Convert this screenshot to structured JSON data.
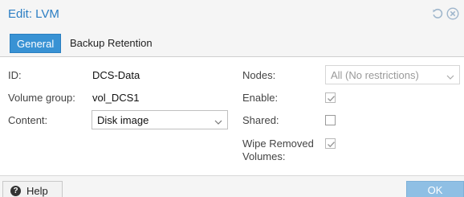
{
  "window": {
    "title": "Edit: LVM"
  },
  "tabs": [
    {
      "label": "General",
      "active": true
    },
    {
      "label": "Backup Retention",
      "active": false
    }
  ],
  "form": {
    "id": {
      "label": "ID:",
      "value": "DCS-Data"
    },
    "volume_group": {
      "label": "Volume group:",
      "value": "vol_DCS1"
    },
    "content": {
      "label": "Content:",
      "value": "Disk image"
    },
    "nodes": {
      "label": "Nodes:",
      "value": "All (No restrictions)",
      "disabled": true
    },
    "enable": {
      "label": "Enable:",
      "checked": true
    },
    "shared": {
      "label": "Shared:",
      "checked": false
    },
    "wipe_removed_volumes": {
      "label_line1": "Wipe Removed",
      "label_line2": "Volumes:",
      "checked": true
    }
  },
  "footer": {
    "help_label": "Help",
    "help_icon": "question-icon",
    "ok_label": "OK"
  },
  "colors": {
    "title": "#2b7ec4",
    "active_tab": "#3892d4",
    "ok_button_disabled": "#8fbfe4"
  },
  "icons": {
    "reset": "reset-icon",
    "close": "close-icon"
  }
}
